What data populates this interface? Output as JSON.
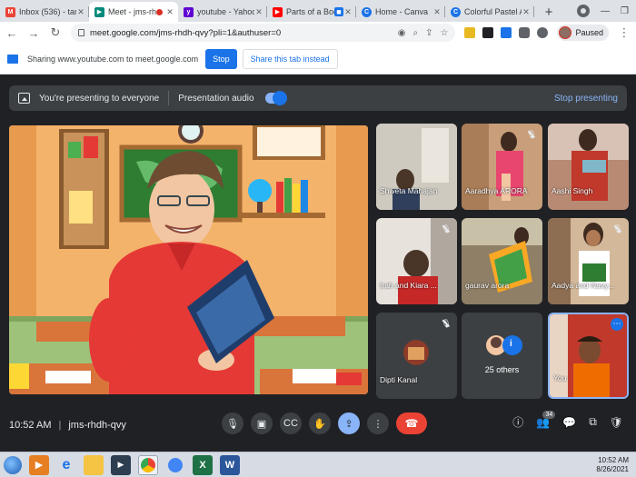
{
  "browser": {
    "tabs": [
      {
        "title": "Inbox (536) - tarannum",
        "icon": "gmail-icon",
        "color": "#ea4335",
        "active": false
      },
      {
        "title": "Meet - jms-rhdh-q",
        "icon": "meet-icon",
        "color": "#00897b",
        "active": true,
        "recording": true
      },
      {
        "title": "youtube - Yahoo India",
        "icon": "yahoo-icon",
        "color": "#6001d2",
        "active": false
      },
      {
        "title": "Parts of a Book | Ja",
        "icon": "youtube-icon",
        "color": "#ff0000",
        "active": false
      },
      {
        "title": "Home - Canva",
        "icon": "canva-icon",
        "color": "#1a73e8",
        "active": false
      },
      {
        "title": "Colorful Pastel Animat",
        "icon": "canva-icon",
        "color": "#1a73e8",
        "active": false
      }
    ],
    "url": "meet.google.com/jms-rhdh-qvy?pli=1&authuser=0",
    "profile_label": "Paused"
  },
  "sharing_bar": {
    "text": "Sharing www.youtube.com to meet.google.com",
    "stop_label": "Stop",
    "share_tab_label": "Share this tab instead"
  },
  "presenting_bar": {
    "status": "You're presenting to everyone",
    "audio_label": "Presentation audio",
    "stop_label": "Stop presenting"
  },
  "participants": [
    {
      "name": "Shweta Mahajan",
      "muted": false
    },
    {
      "name": "Aaradhya ARORA",
      "muted": true
    },
    {
      "name": "Aashi Singh",
      "muted": false
    },
    {
      "name": "Irah and Kiara ...",
      "muted": true
    },
    {
      "name": "gaurav arora",
      "muted": false
    },
    {
      "name": "Aadya and Navy...",
      "muted": true
    },
    {
      "name": "Dipti Kanal",
      "muted": true
    },
    {
      "name": "25 others",
      "muted": false
    },
    {
      "name": "You",
      "muted": false
    }
  ],
  "meeting": {
    "time": "10:52 AM",
    "code": "jms-rhdh-qvy",
    "participant_count": "34"
  },
  "taskbar": {
    "time": "10:52 AM",
    "date": "8/26/2021"
  }
}
